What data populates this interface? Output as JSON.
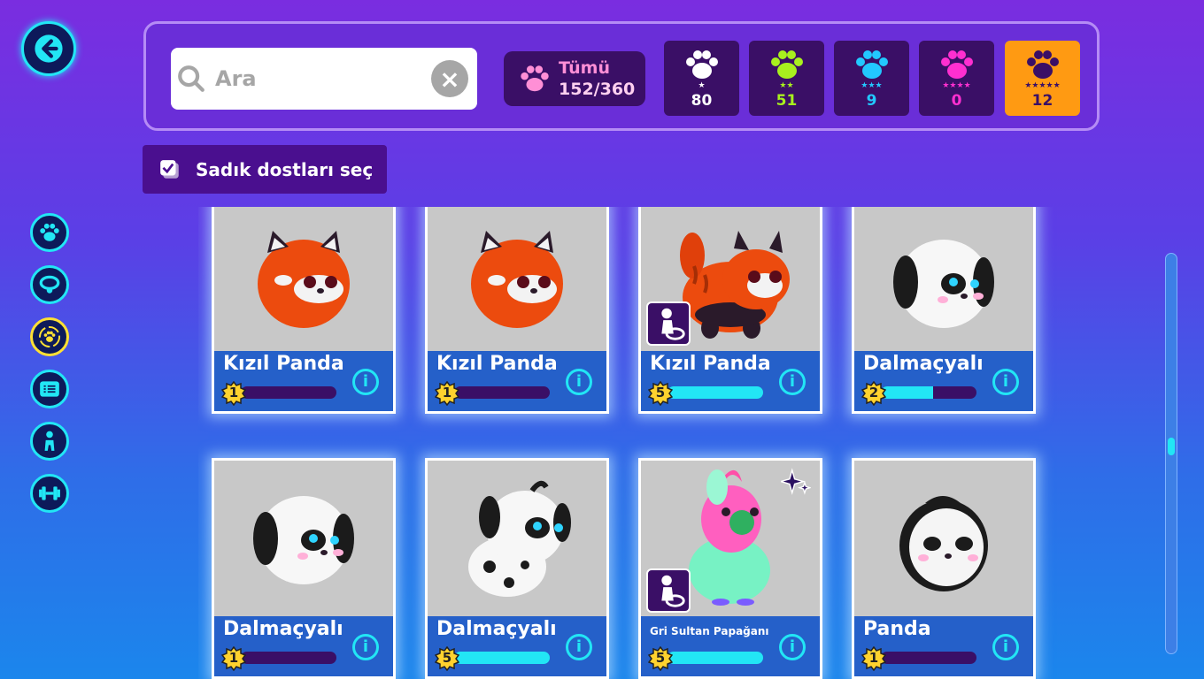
{
  "search": {
    "placeholder": "Ara"
  },
  "total": {
    "label": "Tümü",
    "count": "152/360"
  },
  "rarities": [
    {
      "stars": "★",
      "count": "80",
      "color": "#ffffff",
      "bg": "#3a0f66"
    },
    {
      "stars": "★★",
      "count": "51",
      "color": "#a8f01e",
      "bg": "#3a0f66"
    },
    {
      "stars": "★★★",
      "count": "9",
      "color": "#22c8ff",
      "bg": "#3a0f66"
    },
    {
      "stars": "★★★★",
      "count": "0",
      "color": "#ff2fd0",
      "bg": "#3a0f66"
    },
    {
      "stars": "★★★★★",
      "count": "12",
      "color": "#3a0f66",
      "bg": "#ff9a12"
    }
  ],
  "select_button": {
    "label": "Sadık dostları seç"
  },
  "pets": [
    {
      "name": "Kızıl Panda",
      "level": "1",
      "progress": 0,
      "kind": "redpanda",
      "badge": false
    },
    {
      "name": "Kızıl Panda",
      "level": "1",
      "progress": 0,
      "kind": "redpanda",
      "badge": false
    },
    {
      "name": "Kızıl Panda",
      "level": "5",
      "progress": 1.0,
      "kind": "redpanda2",
      "badge": true
    },
    {
      "name": "Dalmaçyalı",
      "level": "2",
      "progress": 0.55,
      "kind": "dalmatian",
      "badge": false
    },
    {
      "name": "Dalmaçyalı",
      "level": "1",
      "progress": 0,
      "kind": "dalmatian",
      "badge": false
    },
    {
      "name": "Dalmaçyalı",
      "level": "5",
      "progress": 1.0,
      "kind": "dalmatian2",
      "badge": false
    },
    {
      "name": "Gri Sultan Papağanı",
      "level": "5",
      "progress": 1.0,
      "kind": "parrot",
      "badge": true,
      "sparkle": true
    },
    {
      "name": "Panda",
      "level": "1",
      "progress": 0,
      "kind": "panda",
      "badge": false
    }
  ],
  "icons": {
    "back": "arrow-left-icon",
    "search": "magnifier-icon",
    "clear": "close-circle-icon",
    "sidebar": [
      "paw-icon",
      "collar-icon",
      "paw-cycle-icon",
      "list-icon",
      "trainer-icon",
      "dumbbell-icon"
    ]
  }
}
